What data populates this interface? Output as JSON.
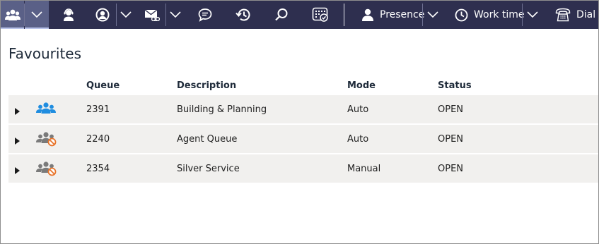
{
  "toolbar": {
    "presence_label": "Presence",
    "worktime_label": "Work time",
    "dial_label": "Dial",
    "icons": [
      "queues-icon",
      "agent-icon",
      "account-icon",
      "voicemail-icon",
      "chat-icon",
      "history-icon",
      "search-icon",
      "dialpad-icon",
      "presence-icon",
      "worktime-icon",
      "phone-icon"
    ]
  },
  "page": {
    "title": "Favourites"
  },
  "table": {
    "headers": {
      "queue": "Queue",
      "description": "Description",
      "mode": "Mode",
      "status": "Status"
    },
    "rows": [
      {
        "queue": "2391",
        "description": "Building & Planning",
        "mode": "Auto",
        "status": "OPEN",
        "icon": "queue-active-icon"
      },
      {
        "queue": "2240",
        "description": "Agent Queue",
        "mode": "Auto",
        "status": "OPEN",
        "icon": "queue-blocked-icon"
      },
      {
        "queue": "2354",
        "description": "Silver Service",
        "mode": "Manual",
        "status": "OPEN",
        "icon": "queue-blocked-icon"
      }
    ]
  },
  "colors": {
    "toolbar_bg": "#2e2f4f",
    "toolbar_active": "#5a6087",
    "row_bg": "#f1f0ee",
    "queue_active_icon": "#1f8de0",
    "queue_blocked_icon": "#7a7a7a",
    "blocked_badge": "#e8742a"
  }
}
